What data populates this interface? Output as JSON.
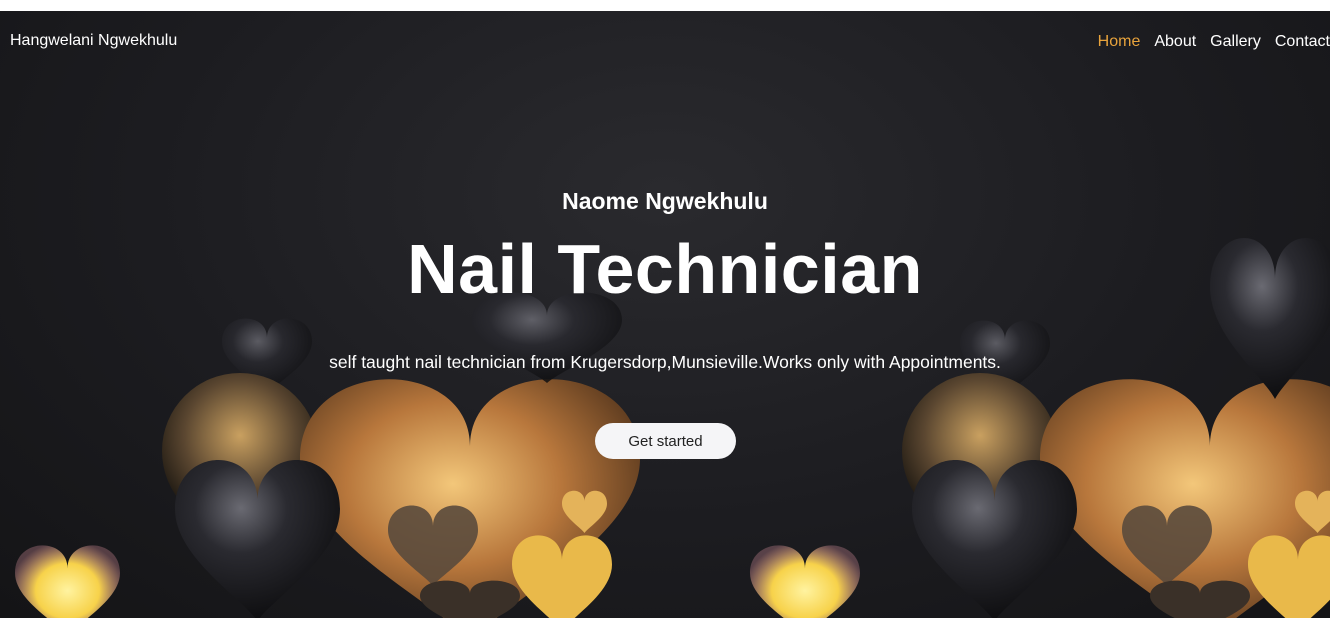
{
  "navbar": {
    "brand": "Hangwelani Ngwekhulu",
    "links": [
      {
        "label": "Home",
        "active": true
      },
      {
        "label": "About",
        "active": false
      },
      {
        "label": "Gallery",
        "active": false
      },
      {
        "label": "Contact",
        "active": false
      }
    ],
    "active_color": "#e8a33c"
  },
  "hero": {
    "subtitle": "Naome Ngwekhulu",
    "title": "Nail Technician",
    "tagline": "self taught nail technician from Krugersdorp,Munsieville.Works only with Appointments.",
    "cta_label": "Get started",
    "background_image": "glowing golden and black hearts"
  }
}
